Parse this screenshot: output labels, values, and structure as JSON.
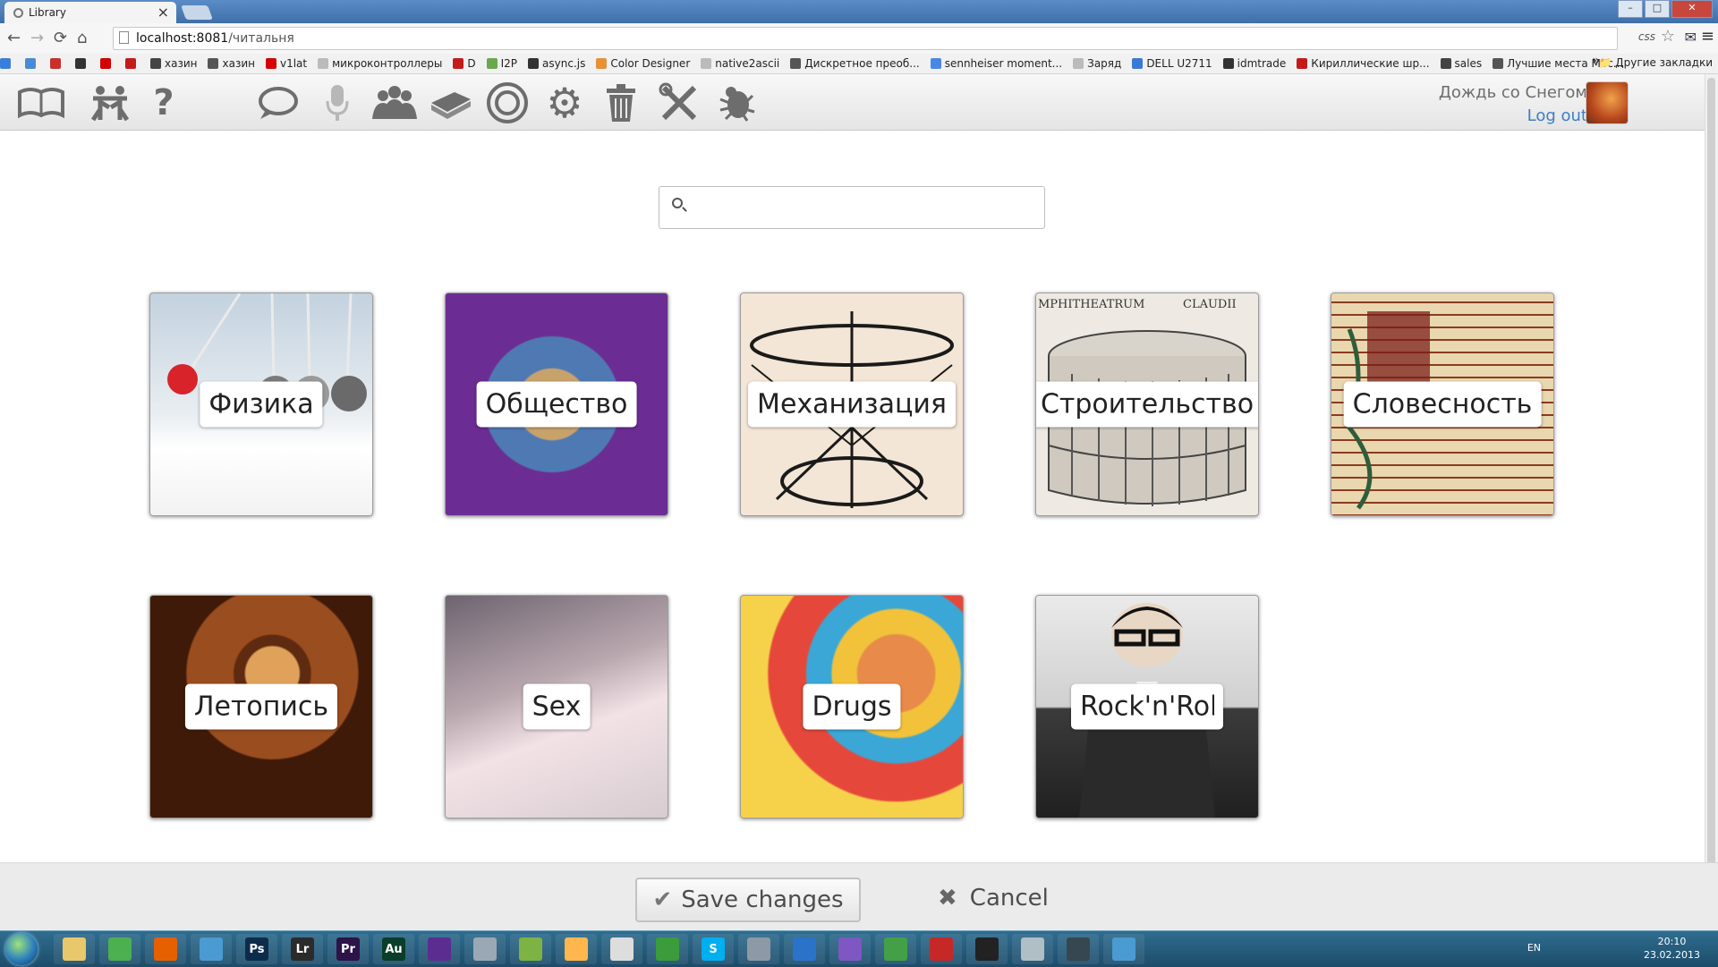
{
  "browser": {
    "tab_title": "Library",
    "url_host": "localhost:8081",
    "url_path": "/читальня",
    "css_label": "css",
    "bookmarks": [
      {
        "label": "",
        "color": "#3b7ddd"
      },
      {
        "label": "",
        "color": "#4a8ad4"
      },
      {
        "label": "",
        "color": "#c8302c"
      },
      {
        "label": "",
        "color": "#333333"
      },
      {
        "label": "",
        "color": "#d40000"
      },
      {
        "label": "",
        "color": "#c31b1b"
      },
      {
        "label": "хазин",
        "color": "#444444"
      },
      {
        "label": "хазин",
        "color": "#555555"
      },
      {
        "label": "v1lat",
        "color": "#d40000"
      },
      {
        "label": "микроконтроллеры",
        "color": "#bbbbbb"
      },
      {
        "label": "D",
        "color": "#c31b1b"
      },
      {
        "label": "I2P",
        "color": "#6aa84f"
      },
      {
        "label": "async.js",
        "color": "#333333"
      },
      {
        "label": "Color Designer",
        "color": "#e69138"
      },
      {
        "label": "native2ascii",
        "color": "#bbbbbb"
      },
      {
        "label": "Дискретное преоб...",
        "color": "#555555"
      },
      {
        "label": "sennheiser moment...",
        "color": "#4a86e8"
      },
      {
        "label": "Заряд",
        "color": "#bbbbbb"
      },
      {
        "label": "DELL U2711",
        "color": "#3c78d8"
      },
      {
        "label": "idmtrade",
        "color": "#333333"
      },
      {
        "label": "Кириллические шр...",
        "color": "#c31b1b"
      },
      {
        "label": "sales",
        "color": "#444444"
      },
      {
        "label": "Лучшие места Мос...",
        "color": "#555555"
      }
    ],
    "other_bookmarks": "Другие закладки",
    "chevron": "»"
  },
  "toolbar": {
    "tools": [
      {
        "name": "library-book-icon",
        "glyph": "📖"
      },
      {
        "name": "people-icon",
        "glyph": "👥"
      },
      {
        "name": "help-icon",
        "glyph": "?"
      },
      {
        "name": "chat-bubble-icon",
        "glyph": "💬"
      },
      {
        "name": "microphone-icon",
        "glyph": "🎤"
      },
      {
        "name": "group-icon",
        "glyph": "👪"
      },
      {
        "name": "books-stack-icon",
        "glyph": "📚"
      },
      {
        "name": "target-icon",
        "glyph": "◎"
      },
      {
        "name": "gear-icon",
        "glyph": "⚙"
      },
      {
        "name": "trash-icon",
        "glyph": "🗑"
      },
      {
        "name": "tools-icon",
        "glyph": "✂"
      },
      {
        "name": "bug-icon",
        "glyph": "🐞"
      }
    ],
    "user_name": "Дождь со Снегом",
    "logout": "Log out"
  },
  "search": {
    "placeholder": ""
  },
  "categories": [
    {
      "label": "Физика"
    },
    {
      "label": "Общество"
    },
    {
      "label": "Механизация"
    },
    {
      "label": "Строительство"
    },
    {
      "label": "Словесность"
    },
    {
      "label": "Летопись"
    },
    {
      "label": "Sex"
    },
    {
      "label": "Drugs"
    },
    {
      "label": "Rock'n'Roll"
    }
  ],
  "tile_art": {
    "mech_caption": "",
    "build_caption_left": "MPHITHEATRUM",
    "build_caption_right": "CLAUDII"
  },
  "footer": {
    "save": "Save changes",
    "cancel": "Cancel"
  },
  "taskbar": {
    "apps": [
      {
        "name": "explorer",
        "label": "",
        "color": "#e8c86a"
      },
      {
        "name": "chrome",
        "label": "",
        "color": "#4caf50"
      },
      {
        "name": "firefox",
        "label": "",
        "color": "#e66000"
      },
      {
        "name": "app-blue",
        "label": "",
        "color": "#4a9bd1"
      },
      {
        "name": "photoshop",
        "label": "Ps",
        "color": "#0d2c4b"
      },
      {
        "name": "lightroom",
        "label": "Lr",
        "color": "#2b2b2b"
      },
      {
        "name": "premiere",
        "label": "Pr",
        "color": "#2c1348"
      },
      {
        "name": "audition",
        "label": "Au",
        "color": "#0a3d2a"
      },
      {
        "name": "visual-studio",
        "label": "",
        "color": "#5c2d91"
      },
      {
        "name": "app-circle",
        "label": "",
        "color": "#9aa8b6"
      },
      {
        "name": "notepad",
        "label": "",
        "color": "#7cb342"
      },
      {
        "name": "paint",
        "label": "",
        "color": "#ffb74d"
      },
      {
        "name": "alien",
        "label": "",
        "color": "#dddddd"
      },
      {
        "name": "utorrent",
        "label": "",
        "color": "#3a9c3a"
      },
      {
        "name": "skype",
        "label": "S",
        "color": "#00aff0"
      },
      {
        "name": "app-tool",
        "label": "",
        "color": "#8d99a6"
      },
      {
        "name": "app-bolt",
        "label": "",
        "color": "#2a73c9"
      },
      {
        "name": "app-purple",
        "label": "",
        "color": "#7e57c2"
      },
      {
        "name": "app-leaf",
        "label": "",
        "color": "#43a047"
      },
      {
        "name": "acrobat",
        "label": "",
        "color": "#c62828"
      },
      {
        "name": "console",
        "label": "",
        "color": "#222222"
      },
      {
        "name": "app-disk",
        "label": "",
        "color": "#b0bec5"
      },
      {
        "name": "steam",
        "label": "",
        "color": "#37474f"
      },
      {
        "name": "app-wave",
        "label": "",
        "color": "#4a9bd1"
      }
    ],
    "lang": "EN",
    "time": "20:10",
    "date": "23.02.2013"
  }
}
